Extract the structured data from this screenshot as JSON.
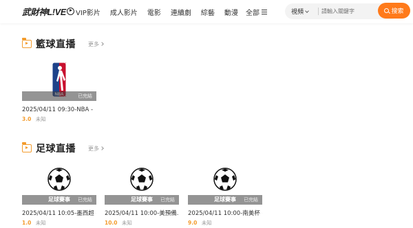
{
  "header": {
    "logo_text": "武財神L!VE",
    "nav": [
      "VIP影片",
      "成人影片",
      "電影",
      "連續劇",
      "綜藝",
      "動漫"
    ],
    "all_label": "全部",
    "search": {
      "type_label": "視頻",
      "placeholder": "請輸入關鍵字",
      "button_label": "搜索"
    }
  },
  "sections": [
    {
      "title": "籃球直播",
      "more_label": "更多",
      "cards": [
        {
          "thumb": "nba-logo",
          "overlay": "已完結",
          "title": "2025/04/11 09:30-NBA -【...",
          "score": "3.0",
          "status": "未知"
        }
      ]
    },
    {
      "title": "足球直播",
      "more_label": "更多",
      "cards": [
        {
          "thumb": "soccer-ball",
          "strip_label": "足球賽事",
          "overlay": "已完結",
          "title": "2025/04/11 10:05-墨西超 -...",
          "score": "1.0",
          "status": "未知"
        },
        {
          "thumb": "soccer-ball",
          "strip_label": "足球賽事",
          "overlay": "已完結",
          "title": "2025/04/11 10:00-美預備...",
          "score": "10.0",
          "status": "未知"
        },
        {
          "thumb": "soccer-ball",
          "strip_label": "足球賽事",
          "overlay": "已完結",
          "title": "2025/04/11 10:00-南美杯 -...",
          "score": "9.0",
          "status": "未知"
        }
      ]
    }
  ],
  "colors": {
    "accent": "#ff7a1a",
    "section_icon": "#f39c2e",
    "score": "#f39c2e"
  }
}
